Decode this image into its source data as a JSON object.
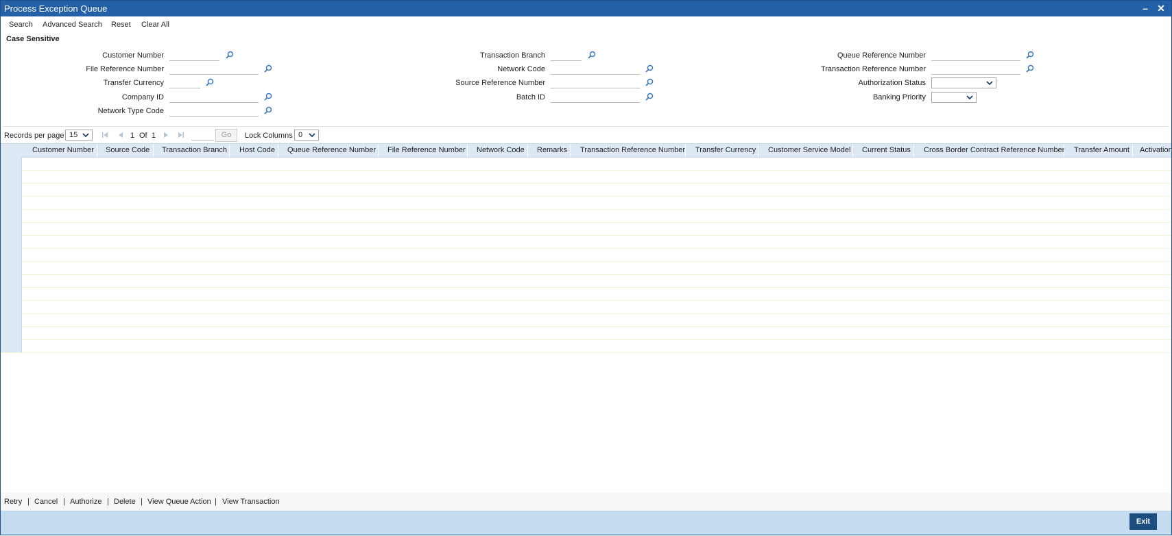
{
  "window": {
    "title": "Process Exception Queue",
    "minimize_icon": "minimize-icon",
    "close_icon": "close-icon"
  },
  "toolbar": {
    "search": "Search",
    "advanced_search": "Advanced Search",
    "reset": "Reset",
    "clear_all": "Clear All"
  },
  "criteria": {
    "section_title": "Case Sensitive",
    "customer_number": "Customer Number",
    "file_reference_number": "File Reference Number",
    "transfer_currency": "Transfer Currency",
    "company_id": "Company ID",
    "network_type_code": "Network Type Code",
    "transaction_branch": "Transaction Branch",
    "network_code": "Network Code",
    "source_reference_number": "Source Reference Number",
    "batch_id": "Batch ID",
    "queue_reference_number": "Queue Reference Number",
    "transaction_reference_number": "Transaction Reference Number",
    "authorization_status": "Authorization Status",
    "banking_priority": "Banking Priority"
  },
  "pager": {
    "records_per_page_label": "Records per page",
    "records_per_page_value": "15",
    "current_page": "1",
    "of_label": "Of",
    "total_pages": "1",
    "go_label": "Go",
    "lock_columns_label": "Lock Columns",
    "lock_columns_value": "0"
  },
  "grid": {
    "columns": [
      "Customer Number",
      "Source Code",
      "Transaction Branch",
      "Host Code",
      "Queue Reference Number",
      "File Reference Number",
      "Network Code",
      "Remarks",
      "Transaction Reference Number",
      "Transfer Currency",
      "Customer Service Model",
      "Current Status",
      "Cross Border Contract Reference Number",
      "Transfer Amount",
      "Activation"
    ],
    "row_count": 15
  },
  "actions": {
    "retry": "Retry",
    "cancel": "Cancel",
    "authorize": "Authorize",
    "delete": "Delete",
    "view_queue_action": "View Queue Action",
    "view_transaction": "View Transaction",
    "separator": "|"
  },
  "footer": {
    "exit": "Exit"
  },
  "colors": {
    "titlebar": "#2460a5",
    "header": "#dce8f4",
    "footer": "#c5dbef",
    "exit_button": "#1c4f7f",
    "lookup_icon": "#3a78c2"
  }
}
